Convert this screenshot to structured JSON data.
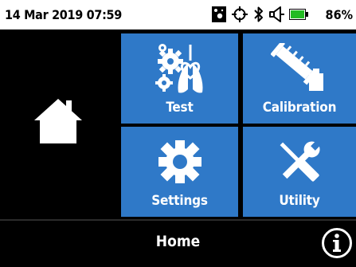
{
  "status_bar": {
    "datetime": "14 Mar 2019 07:59",
    "icons": [
      "image-card-icon",
      "gps-crosshair-icon",
      "bluetooth-icon",
      "speaker-icon",
      "battery-icon"
    ],
    "battery_percent": "86%",
    "battery_color": "#22bb22"
  },
  "sidebar": {
    "icon": "home-icon",
    "icon_color": "#ffffff"
  },
  "tiles": [
    {
      "label": "Test",
      "icon": "lungs-gears-icon"
    },
    {
      "label": "Calibration",
      "icon": "calibration-syringe-icon"
    },
    {
      "label": "Settings",
      "icon": "gear-icon"
    },
    {
      "label": "Utility",
      "icon": "tools-icon"
    }
  ],
  "tile_color": "#2f79c8",
  "bottom_bar": {
    "title": "Home",
    "info_icon": "info-icon"
  }
}
